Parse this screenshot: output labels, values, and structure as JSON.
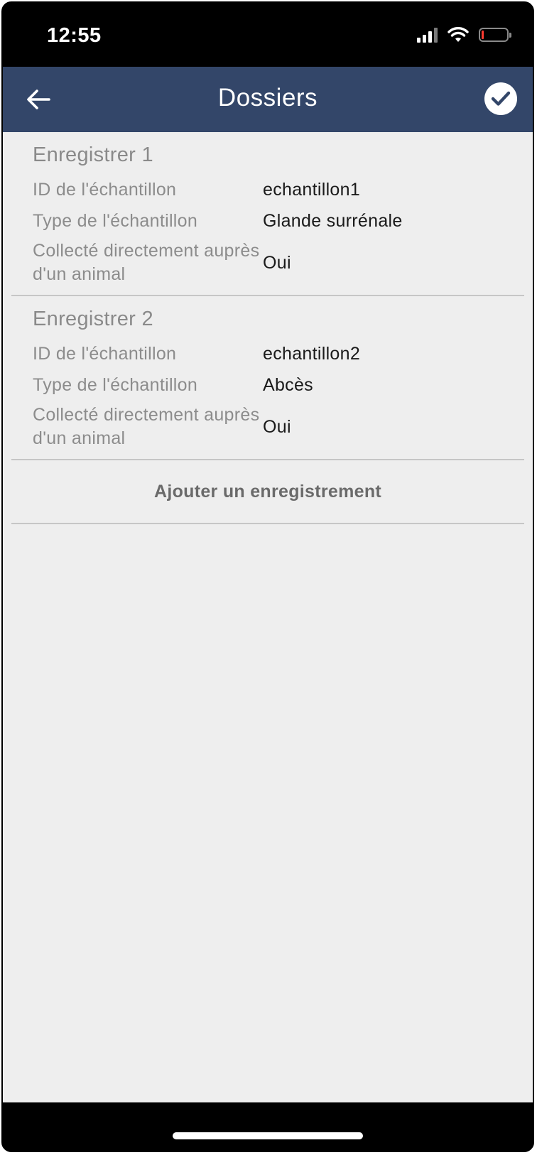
{
  "status_bar": {
    "time": "12:55"
  },
  "header": {
    "title": "Dossiers",
    "back_icon": "arrow-left-icon",
    "confirm_icon": "check-circle-icon"
  },
  "records": [
    {
      "title": "Enregistrer 1",
      "fields": [
        {
          "label": "ID de l'échantillon",
          "value": "echantillon1"
        },
        {
          "label": "Type de l'échantillon",
          "value": "Glande surrénale"
        },
        {
          "label": "Collecté directement auprès d'un animal",
          "value": "Oui"
        }
      ]
    },
    {
      "title": "Enregistrer 2",
      "fields": [
        {
          "label": "ID de l'échantillon",
          "value": "echantillon2"
        },
        {
          "label": "Type de l'échantillon",
          "value": "Abcès"
        },
        {
          "label": "Collecté directement auprès d'un animal",
          "value": "Oui"
        }
      ]
    }
  ],
  "add_record_label": "Ajouter un enregistrement",
  "colors": {
    "header_bg": "#334669",
    "content_bg": "#eeeeee",
    "battery_low": "#ff3b30"
  }
}
